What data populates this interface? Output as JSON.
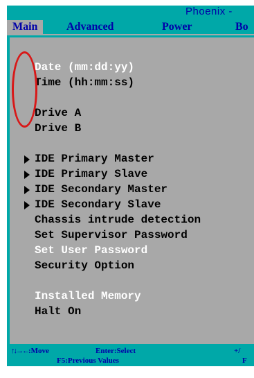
{
  "title": "Phoenix -",
  "menu": {
    "tabs": [
      {
        "label": "Main"
      },
      {
        "label": "Advanced"
      },
      {
        "label": "Power"
      },
      {
        "label": "Bo"
      }
    ]
  },
  "items": [
    {
      "label": "Date (mm:dd:yy)"
    },
    {
      "label": "Time (hh:mm:ss)"
    },
    {
      "label": "Drive A"
    },
    {
      "label": "Drive B"
    },
    {
      "label": "IDE Primary Master"
    },
    {
      "label": "IDE Primary Slave"
    },
    {
      "label": "IDE Secondary Master"
    },
    {
      "label": "IDE Secondary Slave"
    },
    {
      "label": "Chassis intrude detection"
    },
    {
      "label": "Set Supervisor Password"
    },
    {
      "label": "Set User Password"
    },
    {
      "label": "Security Option"
    },
    {
      "label": "Installed Memory"
    },
    {
      "label": "Halt On"
    }
  ],
  "footer": {
    "arrows": "↑↓→←",
    "move": ":Move",
    "enter": "Enter:Select",
    "plus": "+/",
    "f5": "F5:Previous Values",
    "f_trail": "F"
  },
  "colors": {
    "bios_cyan": "#00a8a8",
    "panel_gray": "#a8a8a8",
    "bios_blue": "#0000a8",
    "annotation_red": "#d81818"
  },
  "icons": {
    "submenu": "triangle-right-icon",
    "nav_arrows": "arrow-keys-icon"
  }
}
